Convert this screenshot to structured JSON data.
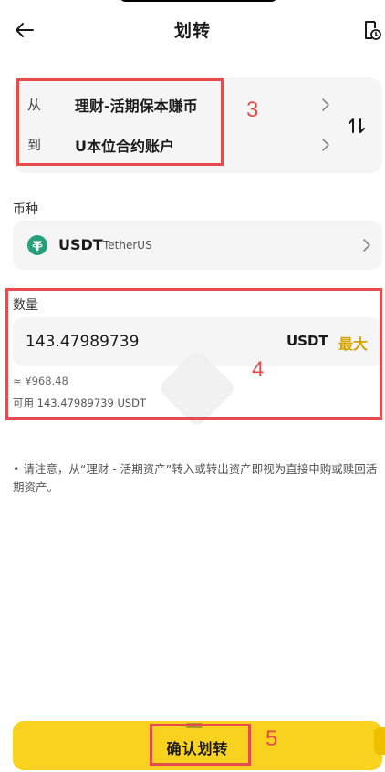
{
  "header": {
    "title": "划转",
    "back_icon": "arrow-left-icon",
    "history_icon": "history-icon"
  },
  "transfer": {
    "from_label": "从",
    "from_account": "理财-活期保本赚币",
    "to_label": "到",
    "to_account": "U本位合约账户",
    "swap_icon": "swap-arrows-icon"
  },
  "coin": {
    "label": "币种",
    "symbol": "USDT",
    "name": "TetherUS",
    "icon": "tether-icon"
  },
  "amount": {
    "label": "数量",
    "value": "143.47989739",
    "unit": "USDT",
    "max_label": "最大",
    "fiat_estimate": "≈ ¥968.48",
    "available": "可用 143.47989739 USDT"
  },
  "notice": "• 请注意，从“理财 - 活期资产”转入或转出资产即视为直接申购或赎回活期资产。",
  "confirm_label": "确认划转",
  "annotations": {
    "a3": "3",
    "a4": "4",
    "a5": "5"
  },
  "colors": {
    "accent": "#f9d11f",
    "max": "#d6a400",
    "annotation": "#e84b4b",
    "tether": "#26a17b"
  }
}
